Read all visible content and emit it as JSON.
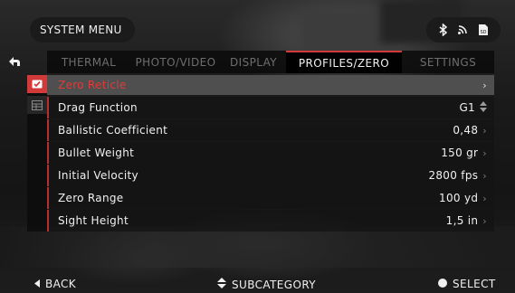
{
  "header": {
    "title": "SYSTEM MENU"
  },
  "status": {
    "icons": [
      "bluetooth-icon",
      "wifi-icon",
      "sd-card-icon"
    ],
    "sd_label": "SD"
  },
  "tabs": [
    {
      "label": "THERMAL",
      "active": false
    },
    {
      "label": "PHOTO/VIDEO",
      "active": false
    },
    {
      "label": "DISPLAY",
      "active": false
    },
    {
      "label": "PROFILES/ZERO",
      "active": true
    },
    {
      "label": "SETTINGS",
      "active": false
    }
  ],
  "rows": [
    {
      "label": "Zero Reticle",
      "value": "",
      "control": "chevron-right"
    },
    {
      "label": "Drag Function",
      "value": "G1",
      "control": "up-down"
    },
    {
      "label": "Ballistic Coefficient",
      "value": "0,48",
      "control": "chevron-right"
    },
    {
      "label": "Bullet Weight",
      "value": "150 gr",
      "control": "chevron-right"
    },
    {
      "label": "Initial Velocity",
      "value": "2800 fps",
      "control": "chevron-right"
    },
    {
      "label": "Zero Range",
      "value": "100 yd",
      "control": "chevron-right"
    },
    {
      "label": "Sight Height",
      "value": "1,5 in",
      "control": "chevron-right"
    }
  ],
  "footer": {
    "back": "BACK",
    "subcategory": "SUBCATEGORY",
    "select": "SELECT"
  },
  "colors": {
    "accent": "#d23a3a",
    "selected_row": "#4f4f4f"
  }
}
